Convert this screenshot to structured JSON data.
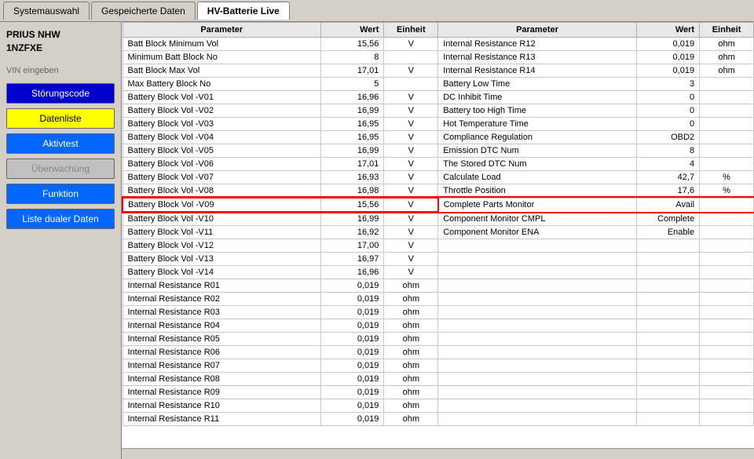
{
  "tabs": [
    {
      "label": "Systemauswahl"
    },
    {
      "label": "Gespeicherte Daten"
    },
    {
      "label": "HV-Batterie Live",
      "active": true
    }
  ],
  "sidebar": {
    "car_title": "PRIUS NHW\n1NZFXE",
    "vin_label": "VIN eingeben",
    "buttons": [
      {
        "label": "Störungscode",
        "style": "blue"
      },
      {
        "label": "Datenliste",
        "style": "yellow"
      },
      {
        "label": "Aktivtest",
        "style": "blue2"
      },
      {
        "label": "Überwachung",
        "style": "gray"
      },
      {
        "label": "Funktion",
        "style": "blue2"
      },
      {
        "label": "Liste dualer Daten",
        "style": "blue2"
      }
    ]
  },
  "table": {
    "headers": {
      "left": {
        "param": "Parameter",
        "val": "Wert",
        "unit": "Einheit"
      },
      "right": {
        "param": "Parameter",
        "val": "Wert",
        "unit": "Einheit"
      }
    },
    "left_rows": [
      {
        "param": "Batt Block Minimum Vol",
        "val": "15,56",
        "unit": "V",
        "highlight": false
      },
      {
        "param": "Minimum Batt Block No",
        "val": "8",
        "unit": "",
        "highlight": false
      },
      {
        "param": "Batt Block Max Vol",
        "val": "17,01",
        "unit": "V",
        "highlight": false
      },
      {
        "param": "Max Battery Block No",
        "val": "5",
        "unit": "",
        "highlight": false
      },
      {
        "param": "Battery Block Vol -V01",
        "val": "16,96",
        "unit": "V",
        "highlight": false
      },
      {
        "param": "Battery Block Vol -V02",
        "val": "16,99",
        "unit": "V",
        "highlight": false
      },
      {
        "param": "Battery Block Vol -V03",
        "val": "16,95",
        "unit": "V",
        "highlight": false
      },
      {
        "param": "Battery Block Vol -V04",
        "val": "16,95",
        "unit": "V",
        "highlight": false
      },
      {
        "param": "Battery Block Vol -V05",
        "val": "16,99",
        "unit": "V",
        "highlight": false
      },
      {
        "param": "Battery Block Vol -V06",
        "val": "17,01",
        "unit": "V",
        "highlight": false
      },
      {
        "param": "Battery Block Vol -V07",
        "val": "16,93",
        "unit": "V",
        "highlight": false
      },
      {
        "param": "Battery Block Vol -V08",
        "val": "16,98",
        "unit": "V",
        "highlight": false
      },
      {
        "param": "Battery Block Vol -V09",
        "val": "15,56",
        "unit": "V",
        "highlight": true
      },
      {
        "param": "Battery Block Vol -V10",
        "val": "16,99",
        "unit": "V",
        "highlight": false
      },
      {
        "param": "Battery Block Vol -V11",
        "val": "16,92",
        "unit": "V",
        "highlight": false
      },
      {
        "param": "Battery Block Vol -V12",
        "val": "17,00",
        "unit": "V",
        "highlight": false
      },
      {
        "param": "Battery Block Vol -V13",
        "val": "16,97",
        "unit": "V",
        "highlight": false
      },
      {
        "param": "Battery Block Vol -V14",
        "val": "16,96",
        "unit": "V",
        "highlight": false
      },
      {
        "param": "Internal Resistance R01",
        "val": "0,019",
        "unit": "ohm",
        "highlight": false
      },
      {
        "param": "Internal Resistance R02",
        "val": "0,019",
        "unit": "ohm",
        "highlight": false
      },
      {
        "param": "Internal Resistance R03",
        "val": "0,019",
        "unit": "ohm",
        "highlight": false
      },
      {
        "param": "Internal Resistance R04",
        "val": "0,019",
        "unit": "ohm",
        "highlight": false
      },
      {
        "param": "Internal Resistance R05",
        "val": "0,019",
        "unit": "ohm",
        "highlight": false
      },
      {
        "param": "Internal Resistance R06",
        "val": "0,019",
        "unit": "ohm",
        "highlight": false
      },
      {
        "param": "Internal Resistance R07",
        "val": "0,019",
        "unit": "ohm",
        "highlight": false
      },
      {
        "param": "Internal Resistance R08",
        "val": "0,019",
        "unit": "ohm",
        "highlight": false
      },
      {
        "param": "Internal Resistance R09",
        "val": "0,019",
        "unit": "ohm",
        "highlight": false
      },
      {
        "param": "Internal Resistance R10",
        "val": "0,019",
        "unit": "ohm",
        "highlight": false
      },
      {
        "param": "Internal Resistance R11",
        "val": "0,019",
        "unit": "ohm",
        "highlight": false
      }
    ],
    "right_rows": [
      {
        "param": "Internal Resistance R12",
        "val": "0,019",
        "unit": "ohm"
      },
      {
        "param": "Internal Resistance R13",
        "val": "0,019",
        "unit": "ohm"
      },
      {
        "param": "Internal Resistance R14",
        "val": "0,019",
        "unit": "ohm"
      },
      {
        "param": "Battery Low Time",
        "val": "3",
        "unit": ""
      },
      {
        "param": "DC Inhibit Time",
        "val": "0",
        "unit": ""
      },
      {
        "param": "Battery too High Time",
        "val": "0",
        "unit": ""
      },
      {
        "param": "Hot Temperature Time",
        "val": "0",
        "unit": ""
      },
      {
        "param": "Compliance Regulation",
        "val": "OBD2",
        "unit": ""
      },
      {
        "param": "Emission DTC Num",
        "val": "8",
        "unit": ""
      },
      {
        "param": "The Stored DTC Num",
        "val": "4",
        "unit": ""
      },
      {
        "param": "Calculate Load",
        "val": "42,7",
        "unit": "%"
      },
      {
        "param": "Throttle Position",
        "val": "17,6",
        "unit": "%"
      },
      {
        "param": "Complete Parts Monitor",
        "val": "Avail",
        "unit": ""
      },
      {
        "param": "Component Monitor CMPL",
        "val": "Complete",
        "unit": ""
      },
      {
        "param": "Component Monitor ENA",
        "val": "Enable",
        "unit": ""
      },
      {
        "param": "",
        "val": "",
        "unit": ""
      },
      {
        "param": "",
        "val": "",
        "unit": ""
      },
      {
        "param": "",
        "val": "",
        "unit": ""
      },
      {
        "param": "",
        "val": "",
        "unit": ""
      },
      {
        "param": "",
        "val": "",
        "unit": ""
      },
      {
        "param": "",
        "val": "",
        "unit": ""
      },
      {
        "param": "",
        "val": "",
        "unit": ""
      },
      {
        "param": "",
        "val": "",
        "unit": ""
      },
      {
        "param": "",
        "val": "",
        "unit": ""
      },
      {
        "param": "",
        "val": "",
        "unit": ""
      },
      {
        "param": "",
        "val": "",
        "unit": ""
      },
      {
        "param": "",
        "val": "",
        "unit": ""
      },
      {
        "param": "",
        "val": "",
        "unit": ""
      },
      {
        "param": "",
        "val": "",
        "unit": ""
      }
    ]
  }
}
